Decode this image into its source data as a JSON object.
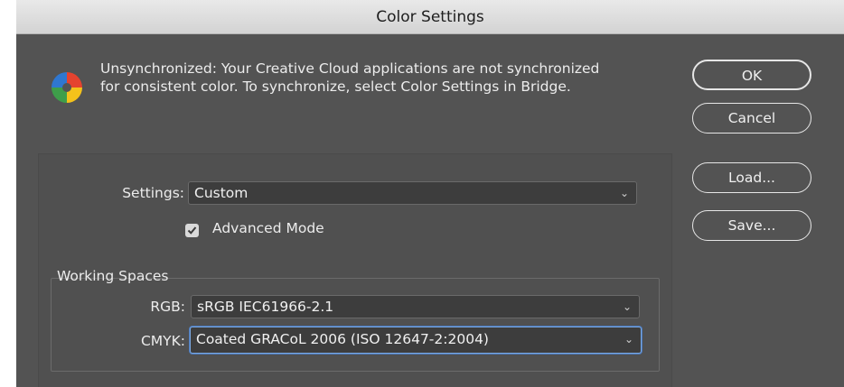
{
  "window": {
    "title": "Color Settings"
  },
  "sync": {
    "icon": "color-wheel-icon",
    "message_line1": "Unsynchronized: Your Creative Cloud applications are not synchronized",
    "message_line2": "for consistent color. To synchronize, select Color Settings in Bridge."
  },
  "buttons": {
    "ok": "OK",
    "cancel": "Cancel",
    "load": "Load...",
    "save": "Save..."
  },
  "settings": {
    "label": "Settings:",
    "value": "Custom"
  },
  "advanced_mode": {
    "label": "Advanced Mode",
    "checked": true
  },
  "working_spaces": {
    "legend": "Working Spaces",
    "rgb": {
      "label": "RGB:",
      "value": "sRGB IEC61966-2.1"
    },
    "cmyk": {
      "label": "CMYK:",
      "value": "Coated GRACoL 2006 (ISO 12647-2:2004)"
    }
  },
  "colors": {
    "background": "#535353",
    "titlebar": "#d6d6d6",
    "focus_ring": "#7ba9e3"
  }
}
